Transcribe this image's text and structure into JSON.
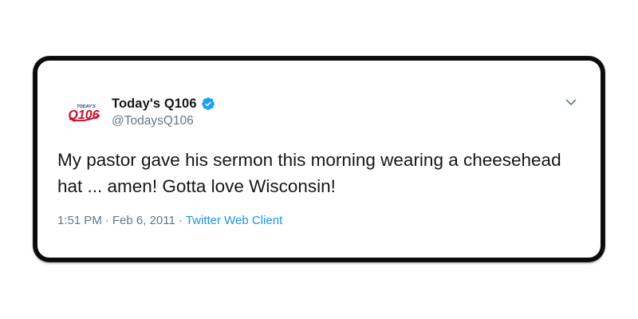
{
  "tweet": {
    "display_name": "Today's Q106",
    "handle": "@TodaysQ106",
    "verified": true,
    "text": "My pastor gave his sermon this morning wearing a cheesehead hat ... amen! Gotta love Wisconsin!",
    "time": "1:51 PM",
    "separator": "·",
    "date": "Feb 6, 2011",
    "client": "Twitter Web Client",
    "avatar_logo": {
      "top_text": "TODAY'S",
      "main_text": "Q106"
    },
    "icons": {
      "verified": "verified-badge-icon",
      "more": "chevron-down-icon"
    }
  },
  "colors": {
    "text": "#14171a",
    "secondary": "#657786",
    "link": "#1b95e0",
    "verified": "#1da1f2",
    "logo_red": "#c8102e",
    "logo_navy": "#1f3c88"
  }
}
